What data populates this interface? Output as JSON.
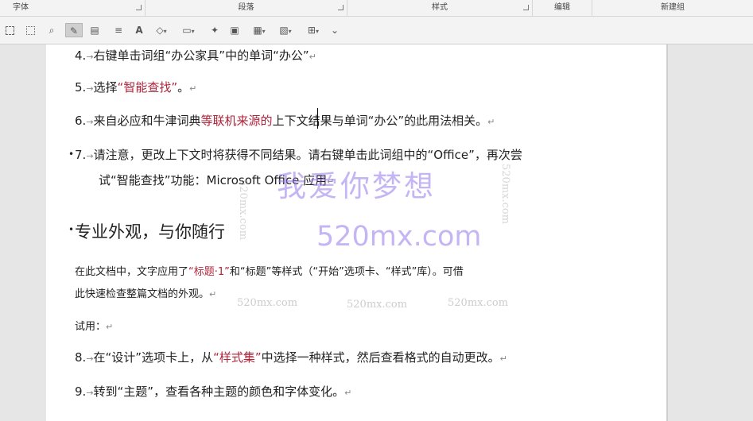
{
  "ribbon_groups": {
    "font": "字体",
    "paragraph": "段落",
    "styles": "样式",
    "editing": "编辑",
    "new_group": "新建组"
  },
  "toolbar_glyphs": {
    "text_a": "A",
    "more": "⌄",
    "caret": "▾"
  },
  "document": {
    "item4": {
      "num": "4.",
      "arrow": "→",
      "text": "右键单击词组“办公家具”中的单词“办公”",
      "mark": "↵"
    },
    "item5": {
      "num": "5.",
      "arrow": "→",
      "pre": "选择",
      "red": "“智能查找”",
      "post": "。",
      "mark": "↵"
    },
    "item6": {
      "num": "6.",
      "arrow": "→",
      "pre": "来自必应和牛津词典",
      "red": "等联机来源的",
      "post": "上下文结果与单词“办公”的此用法相关。",
      "mark": "↵"
    },
    "item7": {
      "bullet": "•",
      "num": "7.",
      "arrow": "→",
      "line1": "请注意，更改上下文时将获得不同结果。请右键单击此词组中的“Office”，再次尝",
      "line2": "试“智能查找”功能：Microsoft Office 应用",
      "mark": "↵"
    },
    "heading": {
      "bullet": "•",
      "text": "专业外观，与你随行"
    },
    "para": {
      "pre": "在此文档中，文字应用了",
      "red": "“标题·1”",
      "mid": "和“标题”等样式（“开始”选项卡、“样式”库）。可借",
      "line2": "此快速检查整篇文档的外观。",
      "mark": "↵"
    },
    "try": {
      "text": "试用：",
      "mark": "↵"
    },
    "item8": {
      "num": "8.",
      "arrow": "→",
      "pre": "在“设计”选项卡上，从",
      "red": "“样式集”",
      "post": "中选择一种样式，然后查看格式的自动更改。",
      "mark": "↵"
    },
    "item9": {
      "num": "9.",
      "arrow": "→",
      "text": "转到“主题”，查看各种主题的颜色和字体变化。",
      "mark": "↵"
    }
  },
  "watermarks": {
    "big": "我爱你梦想",
    "url": "520mx.com",
    "small1": "520mx.com",
    "small2": "520mx.com",
    "small3": "520mx.com",
    "vert_right": "520mx.com",
    "vert_left": "520mx.com",
    "faint_center": "520mx.com"
  }
}
